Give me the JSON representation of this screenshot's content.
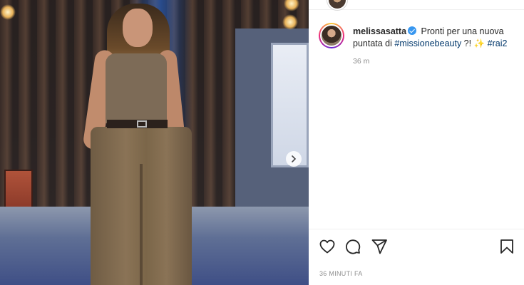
{
  "post": {
    "username": "melissasatta",
    "verified": true,
    "caption_parts": {
      "text_before": "Pronti per una nuova puntata di ",
      "hashtag_1": "#missionebeauty",
      "text_middle": " ?! ",
      "emoji": "✨",
      "hashtag_2": "#rai2"
    },
    "caption_time": "36 m",
    "posted_ago": "36 MINUTI FA"
  },
  "icons": {
    "like": "heart-icon",
    "comment": "comment-icon",
    "share": "send-icon",
    "save": "bookmark-icon",
    "next": "chevron-right-icon",
    "verified": "verified-badge-icon"
  },
  "colors": {
    "link": "#00376b",
    "verified": "#3897f0",
    "muted": "#8e8e8e",
    "text": "#262626"
  }
}
